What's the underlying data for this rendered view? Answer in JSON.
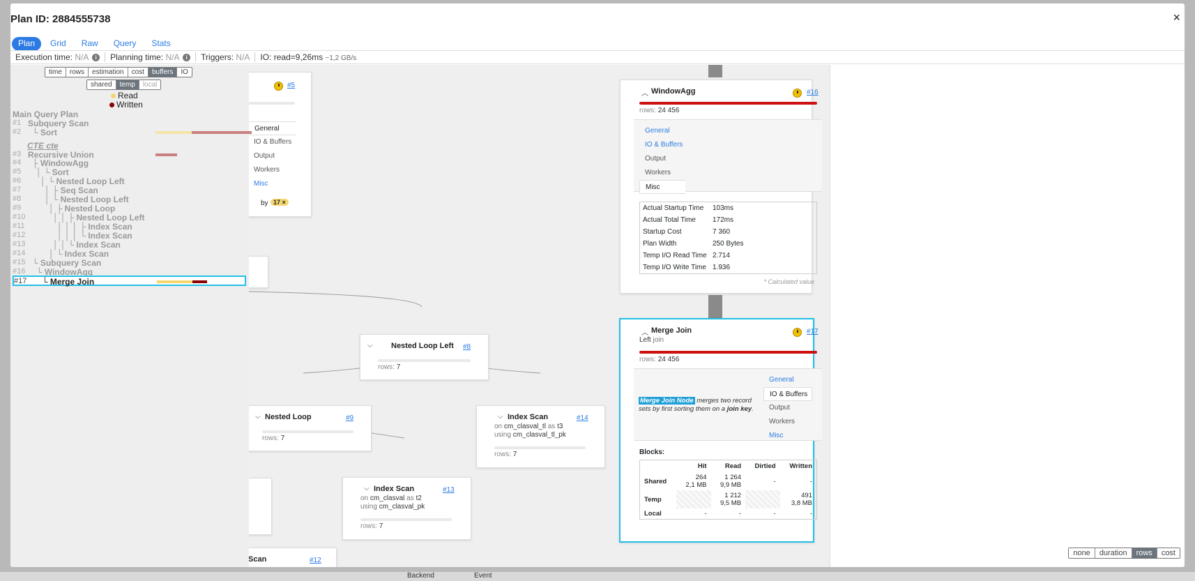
{
  "modal": {
    "title": "Plan ID: 2884555738",
    "close": "×"
  },
  "tabs": [
    {
      "label": "Plan",
      "active": true
    },
    {
      "label": "Grid"
    },
    {
      "label": "Raw"
    },
    {
      "label": "Query"
    },
    {
      "label": "Stats"
    }
  ],
  "infobar": {
    "execution_label": "Execution time:",
    "execution_value": "N/A",
    "planning_label": "Planning time:",
    "planning_value": "N/A",
    "triggers_label": "Triggers:",
    "triggers_value": "N/A",
    "io_label": "IO: read=9,26ms",
    "io_rate": "~1,2 GB/s"
  },
  "left_panel": {
    "metric_buttons": [
      "time",
      "rows",
      "estimation",
      "cost",
      "buffers",
      "IO"
    ],
    "metric_active": "buffers",
    "buffer_buttons": [
      "shared",
      "temp",
      "local"
    ],
    "buffer_active": "temp",
    "legend": {
      "read": "Read",
      "written": "Written"
    },
    "colors": {
      "read": "#f5d76e",
      "written": "#8b0000",
      "read_muted": "#f5e3a8",
      "written_muted": "#c98080"
    },
    "main_plan_label": "Main Query Plan",
    "cte_label": "CTE cte",
    "tree": [
      {
        "num": "#1",
        "prefix": "",
        "name": "Subquery Scan"
      },
      {
        "num": "#2",
        "prefix": "└ ",
        "name": "Sort",
        "read": 0.42,
        "written": 0.69
      },
      {
        "num": "#3",
        "prefix": "",
        "name": "Recursive Union",
        "written": 0.25
      },
      {
        "num": "#4",
        "prefix": "├ ",
        "name": "WindowAgg"
      },
      {
        "num": "#5",
        "prefix": "│ └ ",
        "name": "Sort"
      },
      {
        "num": "#6",
        "prefix": "│   └ ",
        "name": "Nested Loop Left"
      },
      {
        "num": "#7",
        "prefix": "│     ├ ",
        "name": "Seq Scan"
      },
      {
        "num": "#8",
        "prefix": "│     └ ",
        "name": "Nested Loop Left"
      },
      {
        "num": "#9",
        "prefix": "│       ├ ",
        "name": "Nested Loop"
      },
      {
        "num": "#10",
        "prefix": "│       │ ├ ",
        "name": "Nested Loop Left"
      },
      {
        "num": "#11",
        "prefix": "│       │ │ ├ ",
        "name": "Index Scan"
      },
      {
        "num": "#12",
        "prefix": "│       │ │ └ ",
        "name": "Index Scan"
      },
      {
        "num": "#13",
        "prefix": "│       │ └ ",
        "name": "Index Scan"
      },
      {
        "num": "#14",
        "prefix": "│       └ ",
        "name": "Index Scan"
      },
      {
        "num": "#15",
        "prefix": "└ ",
        "name": "Subquery Scan"
      },
      {
        "num": "#16",
        "prefix": "  └ ",
        "name": "WindowAgg"
      },
      {
        "num": "#17",
        "prefix": "    └ ",
        "name": "Merge Join",
        "read": 0.41,
        "written": 0.17,
        "selected": true
      }
    ]
  },
  "nodes": {
    "n5": {
      "id": "#5",
      "tabs": [
        "General",
        "IO & Buffers",
        "Output",
        "Workers",
        "Misc"
      ],
      "by_label": "by",
      "badge": "17 ×"
    },
    "n8": {
      "title": "Nested Loop Left",
      "id": "#8",
      "rows_label": "rows:",
      "rows": "7"
    },
    "n9": {
      "title": "Nested Loop",
      "id": "#9",
      "rows_label": "rows:",
      "rows": "7"
    },
    "n13": {
      "title": "Index Scan",
      "id": "#13",
      "on_label": "on",
      "table": "cm_clasval",
      "as_label": "as",
      "alias": "t2",
      "using_label": "using",
      "index": "cm_clasval_pk",
      "rows_label": "rows:",
      "rows": "7"
    },
    "n14": {
      "title": "Index Scan",
      "id": "#14",
      "on_label": "on",
      "table": "cm_clasval_tl",
      "as_label": "as",
      "alias": "t3",
      "using_label": "using",
      "index": "cm_clasval_tl_pk",
      "rows_label": "rows:",
      "rows": "7"
    },
    "n12": {
      "title": "Scan",
      "id": "#12"
    },
    "n16": {
      "title": "WindowAgg",
      "id": "#16",
      "rows_label": "rows:",
      "rows": "24 456",
      "tabs": [
        {
          "label": "General",
          "active": false
        },
        {
          "label": "IO & Buffers",
          "active": false
        },
        {
          "label": "Output",
          "active": false
        },
        {
          "label": "Workers",
          "active": false
        },
        {
          "label": "Misc",
          "active": true
        }
      ],
      "misc": [
        {
          "k": "Actual Startup Time",
          "v": "103ms"
        },
        {
          "k": "Actual Total Time",
          "v": "172ms"
        },
        {
          "k": "Startup Cost",
          "v": "7 360"
        },
        {
          "k": "Plan Width",
          "v": "250 Bytes"
        },
        {
          "k": "Temp I/O Read Time",
          "v": "2.714"
        },
        {
          "k": "Temp I/O Write Time",
          "v": "1.936"
        }
      ],
      "calc_note": "* Calculated value"
    },
    "n17": {
      "title": "Merge Join",
      "id": "#17",
      "subtitle_a": "Left",
      "subtitle_b": "join",
      "rows_label": "rows:",
      "rows": "24 456",
      "tabs": [
        {
          "label": "General",
          "active": false
        },
        {
          "label": "IO & Buffers",
          "active": true
        },
        {
          "label": "Output",
          "active": false
        },
        {
          "label": "Workers",
          "active": false
        },
        {
          "label": "Misc",
          "active": false
        }
      ],
      "desc_badge": "Merge Join Node",
      "desc_text_1": "merges two record",
      "desc_text_2": "sets by first sorting them on a",
      "desc_key": "join key",
      "desc_end": ".",
      "blocks_label": "Blocks:",
      "blocks_headers": [
        "Hit",
        "Read",
        "Dirtied",
        "Written"
      ],
      "blocks_rows": [
        {
          "label": "Shared",
          "hit": "264",
          "hit2": "2,1 MB",
          "read": "1 264",
          "read2": "9,9 MB",
          "dirtied": "-",
          "written": "-"
        },
        {
          "label": "Temp",
          "read": "1 212",
          "read2": "9,5 MB",
          "written": "491",
          "written2": "3,8 MB"
        },
        {
          "label": "Local",
          "hit": "-",
          "read": "-",
          "dirtied": "-",
          "written": "-"
        }
      ]
    }
  },
  "format_buttons": [
    "none",
    "duration",
    "rows",
    "cost"
  ],
  "format_active": "rows",
  "background_strip": [
    "Backend",
    "Event"
  ]
}
